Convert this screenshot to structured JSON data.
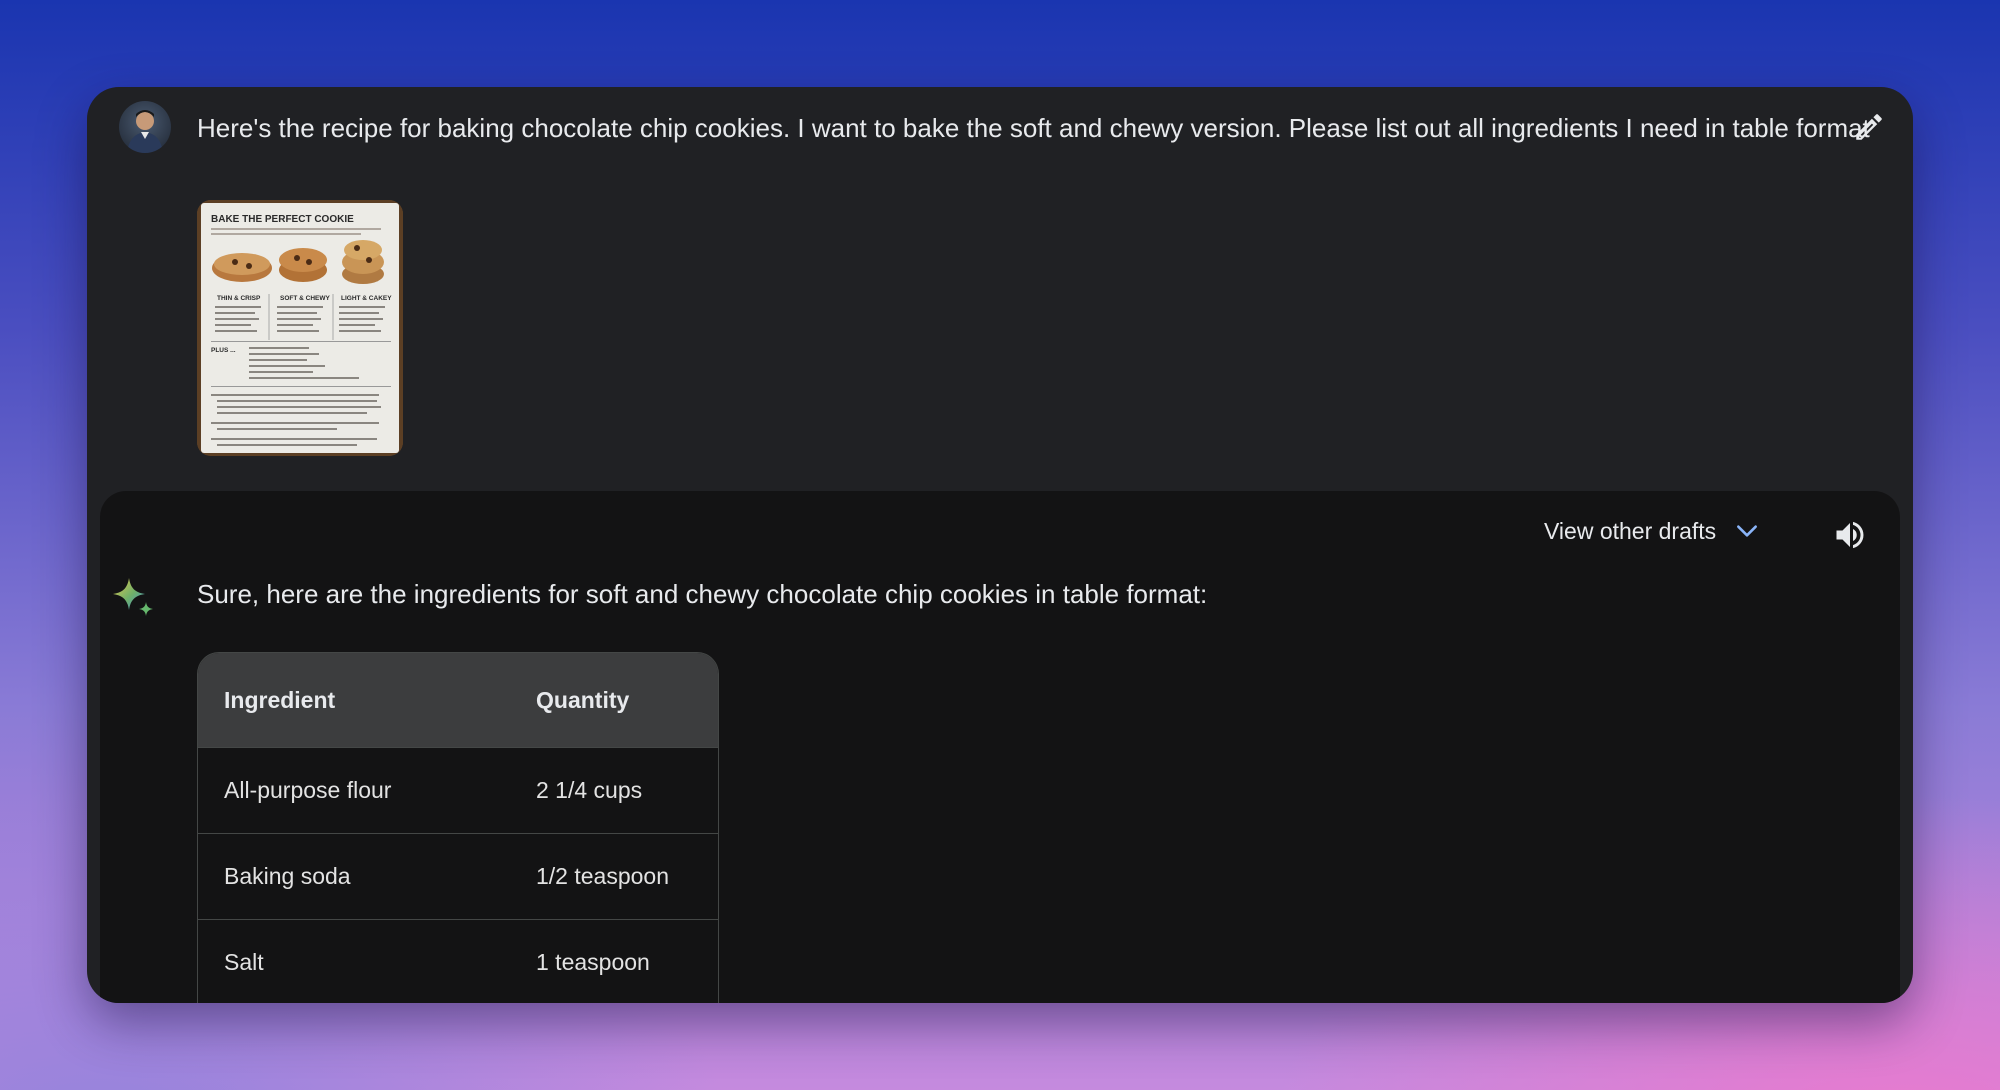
{
  "prompt": {
    "text": "Here's the recipe for baking chocolate chip cookies. I want to bake the soft and chewy version. Please list out all ingredients I need in table format"
  },
  "attachment": {
    "title": "BAKE THE PERFECT COOKIE",
    "columns": [
      "THIN & CRISP",
      "SOFT & CHEWY",
      "LIGHT & CAKEY"
    ],
    "plus_label": "PLUS ..."
  },
  "response": {
    "drafts_label": "View other drafts",
    "text": "Sure, here are the ingredients for soft and chewy chocolate chip cookies in table format:",
    "table": {
      "headers": [
        "Ingredient",
        "Quantity"
      ],
      "rows": [
        [
          "All-purpose flour",
          "2 1/4 cups"
        ],
        [
          "Baking soda",
          "1/2 teaspoon"
        ],
        [
          "Salt",
          "1 teaspoon"
        ]
      ]
    }
  },
  "icons": {
    "edit": "pencil-icon",
    "drafts": "chevron-down-icon",
    "speaker": "speaker-icon",
    "assistant": "sparkle-icon"
  },
  "colors": {
    "card": "#202124",
    "response": "#131314",
    "table_header": "#3c3d3e",
    "chevron": "#8ab4f8"
  }
}
